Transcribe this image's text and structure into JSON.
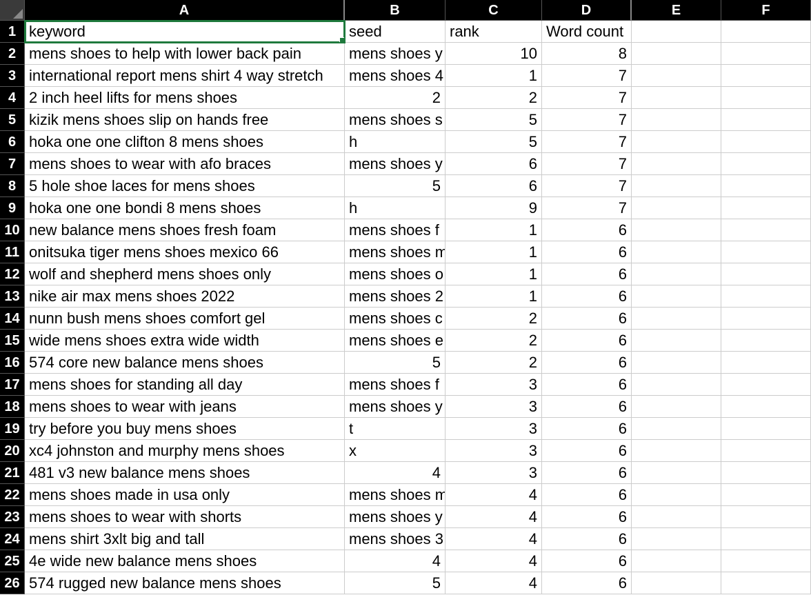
{
  "columns": [
    "A",
    "B",
    "C",
    "D",
    "E",
    "F"
  ],
  "headers": {
    "A": "keyword",
    "B": "seed",
    "C": "rank",
    "D": "Word count",
    "E": "",
    "F": ""
  },
  "rows": [
    {
      "n": 2,
      "A": "mens shoes to help with lower back pain",
      "B": "mens shoes y",
      "C": 10,
      "D": 8
    },
    {
      "n": 3,
      "A": "international report mens shirt 4 way stretch",
      "B": "mens shoes 4",
      "C": 1,
      "D": 7
    },
    {
      "n": 4,
      "A": "2 inch heel lifts for mens shoes",
      "B": "2",
      "C": 2,
      "D": 7,
      "Bnum": true
    },
    {
      "n": 5,
      "A": "kizik mens shoes slip on hands free",
      "B": "mens shoes s",
      "C": 5,
      "D": 7
    },
    {
      "n": 6,
      "A": "hoka one one clifton 8 mens shoes",
      "B": "h",
      "C": 5,
      "D": 7
    },
    {
      "n": 7,
      "A": "mens shoes to wear with afo braces",
      "B": "mens shoes y",
      "C": 6,
      "D": 7
    },
    {
      "n": 8,
      "A": "5 hole shoe laces for mens shoes",
      "B": "5",
      "C": 6,
      "D": 7,
      "Bnum": true
    },
    {
      "n": 9,
      "A": "hoka one one bondi 8 mens shoes",
      "B": "h",
      "C": 9,
      "D": 7
    },
    {
      "n": 10,
      "A": "new balance mens shoes fresh foam",
      "B": "mens shoes f",
      "C": 1,
      "D": 6
    },
    {
      "n": 11,
      "A": "onitsuka tiger mens shoes mexico 66",
      "B": "mens shoes m",
      "C": 1,
      "D": 6
    },
    {
      "n": 12,
      "A": "wolf and shepherd mens shoes only",
      "B": "mens shoes o",
      "C": 1,
      "D": 6
    },
    {
      "n": 13,
      "A": "nike air max mens shoes 2022",
      "B": "mens shoes 2",
      "C": 1,
      "D": 6
    },
    {
      "n": 14,
      "A": "nunn bush mens shoes comfort gel",
      "B": "mens shoes c",
      "C": 2,
      "D": 6
    },
    {
      "n": 15,
      "A": "wide mens shoes extra wide width",
      "B": "mens shoes e",
      "C": 2,
      "D": 6
    },
    {
      "n": 16,
      "A": "574 core new balance mens shoes",
      "B": "5",
      "C": 2,
      "D": 6,
      "Bnum": true
    },
    {
      "n": 17,
      "A": "mens shoes for standing all day",
      "B": "mens shoes f",
      "C": 3,
      "D": 6
    },
    {
      "n": 18,
      "A": "mens shoes to wear with jeans",
      "B": "mens shoes y",
      "C": 3,
      "D": 6
    },
    {
      "n": 19,
      "A": "try before you buy mens shoes",
      "B": "t",
      "C": 3,
      "D": 6
    },
    {
      "n": 20,
      "A": "xc4 johnston and murphy mens shoes",
      "B": "x",
      "C": 3,
      "D": 6
    },
    {
      "n": 21,
      "A": "481 v3 new balance mens shoes",
      "B": "4",
      "C": 3,
      "D": 6,
      "Bnum": true
    },
    {
      "n": 22,
      "A": "mens shoes made in usa only",
      "B": "mens shoes m",
      "C": 4,
      "D": 6
    },
    {
      "n": 23,
      "A": "mens shoes to wear with shorts",
      "B": "mens shoes y",
      "C": 4,
      "D": 6
    },
    {
      "n": 24,
      "A": "mens shirt 3xlt big and tall",
      "B": "mens shoes 3",
      "C": 4,
      "D": 6
    },
    {
      "n": 25,
      "A": "4e wide new balance mens shoes",
      "B": "4",
      "C": 4,
      "D": 6,
      "Bnum": true
    },
    {
      "n": 26,
      "A": "574 rugged new balance mens shoes",
      "B": "5",
      "C": 4,
      "D": 6,
      "Bnum": true
    }
  ],
  "selected_cell": "A1"
}
